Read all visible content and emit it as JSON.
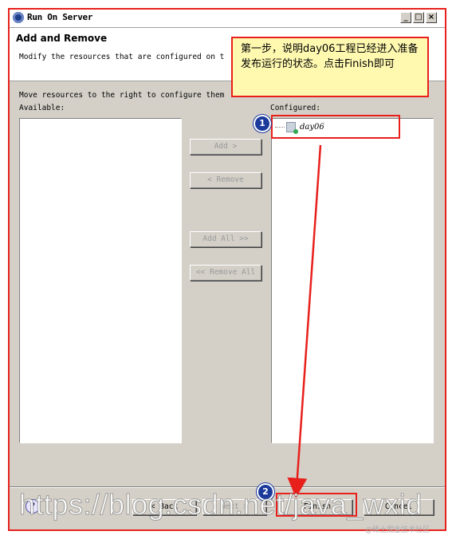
{
  "window": {
    "title": "Run On Server",
    "minimize": "_",
    "maximize": "□",
    "close": "×"
  },
  "header": {
    "title": "Add and Remove",
    "description": "Modify the resources that are configured on t"
  },
  "body": {
    "instruction": "Move resources to the right to configure them",
    "available_label": "Available:",
    "configured_label": "Configured:",
    "configured_items": [
      "day06"
    ]
  },
  "buttons": {
    "add": "Add >",
    "remove": "< Remove",
    "add_all": "Add All >>",
    "remove_all": "<< Remove All"
  },
  "footer": {
    "back": "< Back",
    "next": "Next >",
    "finish": "Finish",
    "cancel": "Cancel",
    "help": "?"
  },
  "annotation": {
    "callout_text": "第一步，说明day06工程已经进入准备发布运行的状态。点击Finish即可",
    "badge_1": "1",
    "badge_2": "2",
    "accent_color": "#e8201c"
  },
  "watermark": {
    "text": "https://blog.csdn.net/java_wxid",
    "corner": "@稀土掘金技术社区"
  }
}
